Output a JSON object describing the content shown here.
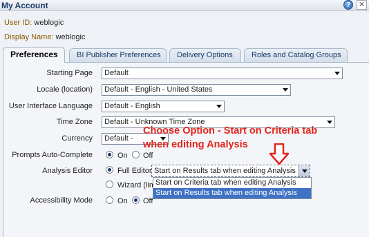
{
  "window": {
    "title": "My Account"
  },
  "user": {
    "id_label": "User ID:",
    "id_value": "weblogic",
    "name_label": "Display Name:",
    "name_value": "weblogic"
  },
  "tabs": [
    {
      "label": "Preferences"
    },
    {
      "label": "BI Publisher Preferences"
    },
    {
      "label": "Delivery Options"
    },
    {
      "label": "Roles and Catalog Groups"
    }
  ],
  "form": {
    "starting_page": {
      "label": "Starting Page",
      "value": "Default"
    },
    "locale": {
      "label": "Locale (location)",
      "value": "Default - English - United States"
    },
    "ui_language": {
      "label": "User Interface Language",
      "value": "Default - English"
    },
    "time_zone": {
      "label": "Time Zone",
      "value": "Default - Unknown Time Zone"
    },
    "currency": {
      "label": "Currency",
      "value": "Default -"
    },
    "prompts_autocomplete": {
      "label": "Prompts Auto-Complete",
      "on": "On",
      "off": "Off",
      "selected": "On"
    },
    "analysis_editor": {
      "label": "Analysis Editor",
      "full_editor": "Full Editor",
      "wizard": "Wizard (lim",
      "selected": "Full Editor",
      "select_value": "Start on Results tab when editing Analysis",
      "options": [
        "Start on Criteria tab when editing Analysis",
        "Start on Results tab when editing Analysis"
      ],
      "highlighted_option": "Start on Results tab when editing Analysis"
    },
    "accessibility_mode": {
      "label": "Accessibility Mode",
      "on": "On",
      "off": "Off",
      "selected": "Off"
    }
  },
  "annotation": {
    "line1": "Choose Option - Start on Criteria tab",
    "line2": "when editing Analysis"
  },
  "colors": {
    "annotation": "#e3241b",
    "highlight": "#3f72c4",
    "title": "#1b3a6b"
  }
}
